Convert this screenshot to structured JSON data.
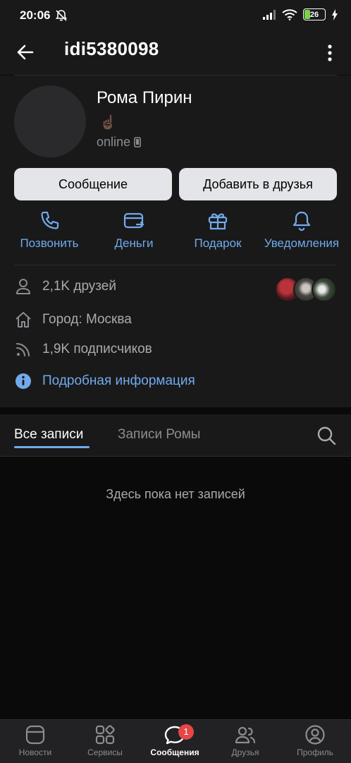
{
  "status_bar": {
    "time": "20:06",
    "battery": "26",
    "icons": [
      "bell-off-icon",
      "signal-icon",
      "wifi-icon",
      "battery-icon",
      "charging-icon"
    ]
  },
  "header": {
    "title": "idi5380098"
  },
  "profile": {
    "name": "Рома Пирин",
    "emoji": "☝🏿",
    "status": "online"
  },
  "buttons": {
    "message": "Сообщение",
    "add_friend": "Добавить в друзья"
  },
  "actions": [
    {
      "label": "Позвонить",
      "icon": "phone-icon"
    },
    {
      "label": "Деньги",
      "icon": "card-icon"
    },
    {
      "label": "Подарок",
      "icon": "gift-icon"
    },
    {
      "label": "Уведомления",
      "icon": "bell-icon"
    }
  ],
  "info": {
    "friends": "2,1K друзей",
    "city": "Город: Москва",
    "followers": "1,9K подписчиков",
    "details": "Подробная информация"
  },
  "posts": {
    "tab_all": "Все записи",
    "tab_own": "Записи Ромы",
    "empty": "Здесь пока нет записей"
  },
  "nav": {
    "items": [
      {
        "label": "Новости",
        "icon": "news-icon"
      },
      {
        "label": "Сервисы",
        "icon": "services-icon"
      },
      {
        "label": "Сообщения",
        "icon": "messages-icon",
        "badge": "1"
      },
      {
        "label": "Друзья",
        "icon": "friends-icon"
      },
      {
        "label": "Профиль",
        "icon": "profile-icon"
      }
    ]
  },
  "colors": {
    "accent": "#71aaeb",
    "background": "#0a0a0a",
    "card": "#19191a",
    "badge": "#e64646"
  }
}
